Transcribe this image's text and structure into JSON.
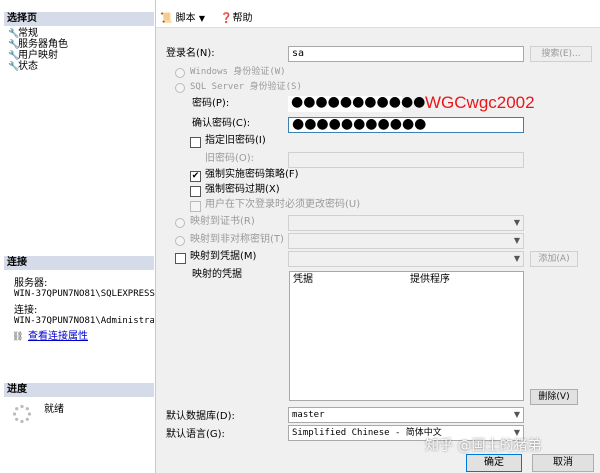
{
  "sidebar": {
    "select_page_header": "选择页",
    "items": [
      {
        "label": "常规"
      },
      {
        "label": "服务器角色"
      },
      {
        "label": "用户映射"
      },
      {
        "label": "状态"
      }
    ],
    "connection_header": "连接",
    "server_label": "服务器:",
    "server_value": "WIN-37QPUN7NO81\\SQLEXPRESS",
    "connection_label": "连接:",
    "connection_value": "WIN-37QPUN7NO81\\Administrat",
    "view_conn_props": "查看连接属性",
    "progress_header": "进度",
    "progress_status": "就绪"
  },
  "toolbar": {
    "script_label": "脚本",
    "help_label": "帮助"
  },
  "form": {
    "login_name_label": "登录名(N):",
    "login_name_value": "sa",
    "search_button": "搜索(E)...",
    "windows_auth": "Windows 身份验证(W)",
    "sql_auth": "SQL Server 身份验证(S)",
    "password_label": "密码(P):",
    "password_dots": "●●●●●●●●●●●",
    "annotation": "WGCwgc2002",
    "confirm_password_label": "确认密码(C):",
    "confirm_password_dots": "●●●●●●●●●●●",
    "specify_old_password": "指定旧密码(I)",
    "old_password_label": "旧密码(O):",
    "enforce_policy": "强制实施密码策略(F)",
    "enforce_expiration": "强制密码过期(X)",
    "must_change": "用户在下次登录时必须更改密码(U)",
    "map_to_cert": "映射到证书(R)",
    "map_to_asym_key": "映射到非对称密钥(T)",
    "map_to_credential": "映射到凭据(M)",
    "add_button": "添加(A)",
    "mapped_credentials_label": "映射的凭据",
    "col_credential": "凭据",
    "col_provider": "提供程序",
    "remove_button": "删除(V)",
    "default_db_label": "默认数据库(D):",
    "default_db_value": "master",
    "default_lang_label": "默认语言(G):",
    "default_lang_value": "Simplified Chinese - 简体中文"
  },
  "footer": {
    "ok_button": "确定",
    "cancel_button": "取消",
    "watermark": "知乎 @国士的猪弟"
  },
  "colors": {
    "annotation": "#e8171b",
    "header_bg": "#d6dbe9",
    "link": "#0000cc"
  }
}
